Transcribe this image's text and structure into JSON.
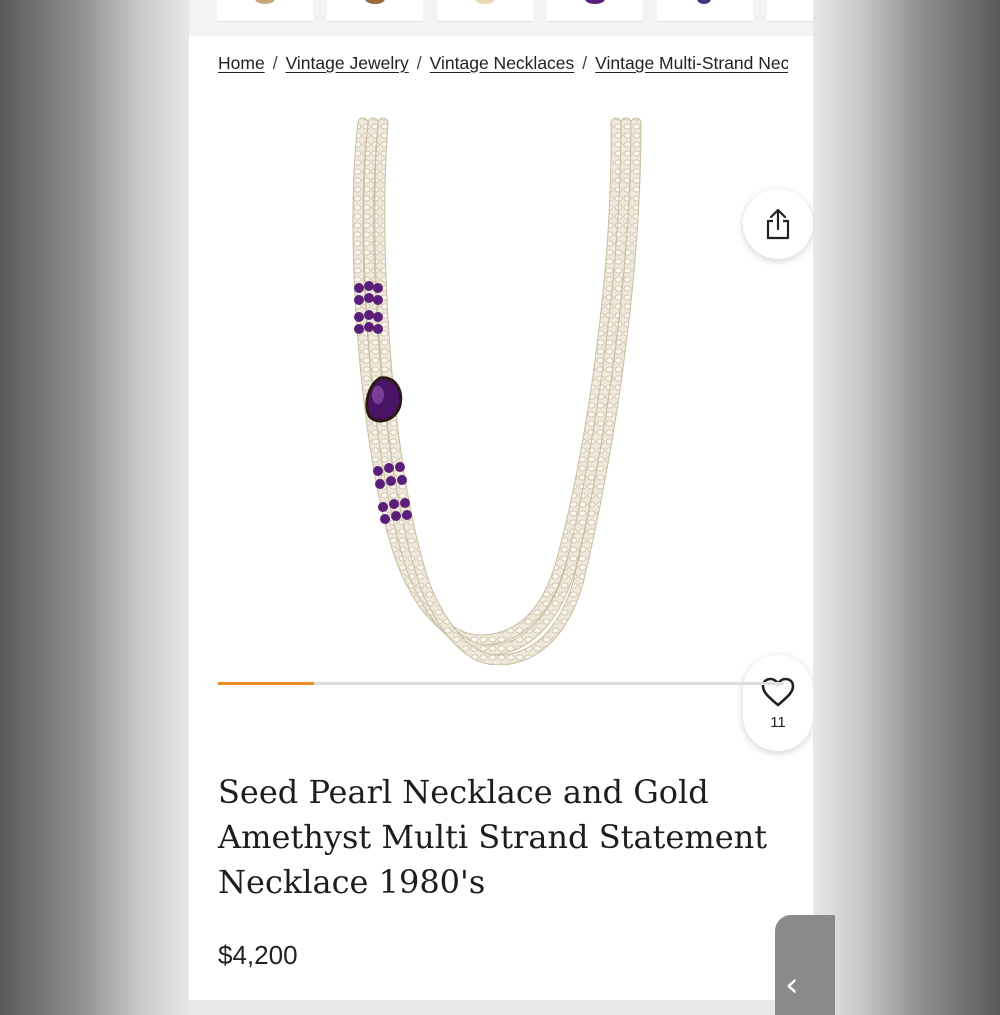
{
  "breadcrumb": {
    "items": [
      "Home",
      "Vintage Jewelry",
      "Vintage Necklaces",
      "Vintage Multi-Strand Necklaces"
    ],
    "separator": "/"
  },
  "gallery": {
    "share_icon": "share-icon",
    "favorite_icon": "heart-icon",
    "favorite_count": "11",
    "progress": 0.17
  },
  "product": {
    "title": "Seed Pearl Necklace and Gold Amethyst Multi Strand Statement Necklace 1980's",
    "price": "$4,200"
  },
  "colors": {
    "accent": "#f08a24",
    "amethyst": "#5b1f7a",
    "pearl": "#ece6d8"
  },
  "side_tab_icon": "chevron-left-icon"
}
